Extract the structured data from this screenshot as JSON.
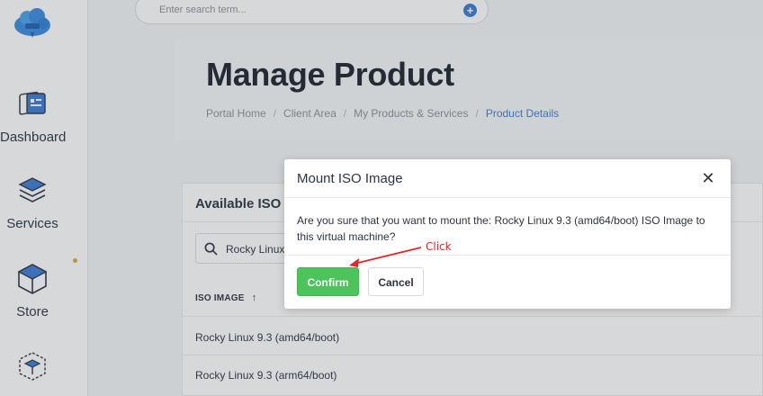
{
  "search": {
    "placeholder": "Enter search term..."
  },
  "sidebar": {
    "items": [
      {
        "label": "Dashboard",
        "icon": "dashboard-icon"
      },
      {
        "label": "Services",
        "icon": "services-icon"
      },
      {
        "label": "Store",
        "icon": "store-icon"
      },
      {
        "label": "",
        "icon": "box-icon"
      }
    ]
  },
  "header": {
    "title": "Manage Product",
    "breadcrumb": [
      "Portal Home",
      "Client Area",
      "My Products & Services",
      "Product Details"
    ]
  },
  "card": {
    "title": "Available ISO Im",
    "filter_value": "Rocky Linux",
    "column_header": "ISO IMAGE",
    "sort_arrow": "↑",
    "rows": [
      "Rocky Linux 9.3 (amd64/boot)",
      "Rocky Linux 9.3 (arm64/boot)"
    ]
  },
  "modal": {
    "title": "Mount ISO Image",
    "close": "✕",
    "body": "Are you sure that you want to mount the: Rocky Linux 9.3 (amd64/boot) ISO Image to this virtual machine?",
    "confirm_label": "Confirm",
    "cancel_label": "Cancel"
  },
  "annotation": {
    "text": "Click"
  },
  "colors": {
    "accent": "#3a7bd5",
    "confirm": "#4cc35b",
    "annotation": "#e0262a",
    "status_dot": "#e0a92c"
  }
}
